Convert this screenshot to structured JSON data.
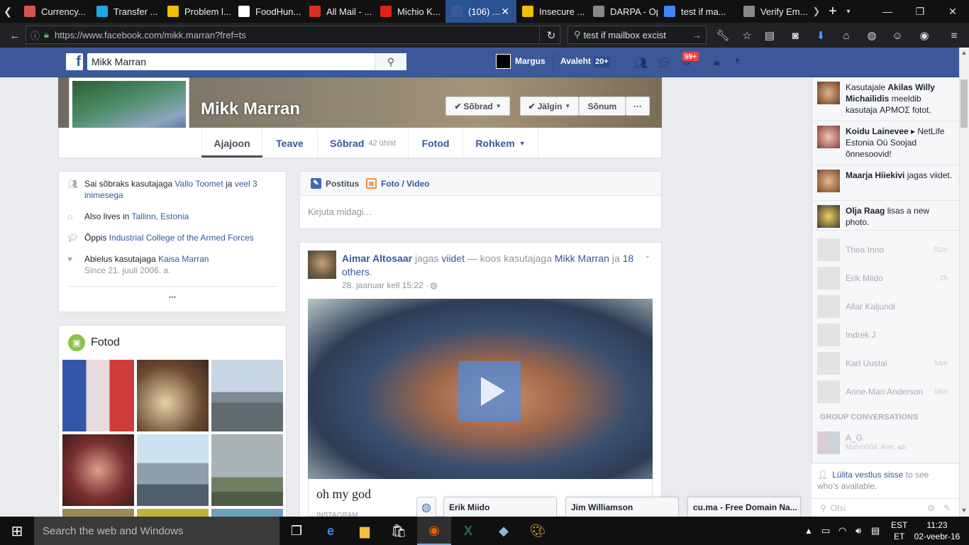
{
  "browser": {
    "tabs": [
      {
        "label": "Currency...",
        "icon": "currency-icon",
        "color": "#d9534f"
      },
      {
        "label": "Transfer ...",
        "icon": "transferwise-icon",
        "color": "#1ea7e1"
      },
      {
        "label": "Problem l...",
        "icon": "warning-icon",
        "color": "#f0c000"
      },
      {
        "label": "FoodHun...",
        "icon": "foodhunter-icon",
        "color": "#ffffff"
      },
      {
        "label": "All Mail - ...",
        "icon": "gmail-icon",
        "color": "#d93025"
      },
      {
        "label": "Michio K...",
        "icon": "youtube-icon",
        "color": "#e62117"
      },
      {
        "label": "(106) ...",
        "icon": "facebook-icon",
        "color": "#3b5998"
      },
      {
        "label": "Insecure ...",
        "icon": "warning-icon",
        "color": "#f0c000"
      },
      {
        "label": "DARPA - Ope...",
        "icon": "blank-icon",
        "color": "#888888"
      },
      {
        "label": "test if ma...",
        "icon": "google-icon",
        "color": "#4285f4"
      },
      {
        "label": "Verify Em...",
        "icon": "blank-icon",
        "color": "#888888"
      }
    ],
    "url": "https://www.facebook.com/mikk.marran?fref=ts",
    "search_query": "test if mailbox excist"
  },
  "fb_header": {
    "search_value": "Mikk Marran",
    "user_name": "Margus",
    "home_label": "Avaleht",
    "home_count": "20+",
    "notif_count": "99+"
  },
  "profile": {
    "name": "Mikk Marran",
    "friends_button": "Sõbrad",
    "follow_button": "Jälgin",
    "message_button": "Sõnum",
    "more_button": "···",
    "tabs": {
      "timeline": "Ajajoon",
      "about": "Teave",
      "friends": "Sõbrad",
      "friends_mutual": "42 ühist",
      "photos": "Fotod",
      "more": "Rohkem"
    }
  },
  "intro": {
    "row1_pre": "Sai sõbraks kasutajaga ",
    "row1_link1": "Vallo Toomet",
    "row1_mid": " ja ",
    "row1_link2": "veel 3 inimesega",
    "row2_pre": "Also lives in ",
    "row2_link": "Tallinn, Estonia",
    "row3_pre": "Õppis ",
    "row3_link": "Industrial College of the Armed Forces",
    "row4_pre": "Abielus kasutajaga ",
    "row4_link": "Kaisa Marran",
    "row4_sub": "Since 21. juuli 2006. a.",
    "more": "•••"
  },
  "photos_card": {
    "title": "Fotod"
  },
  "composer": {
    "tab_post": "Postitus",
    "tab_photo": "Foto / Video",
    "placeholder": "Kirjuta midagi..."
  },
  "post": {
    "author": "Aimar Altosaar",
    "verb": " jagas ",
    "object": "viidet",
    "with": " — koos kasutajaga ",
    "tagged": "Mikk Marran",
    "and": " ja ",
    "others": "18 others",
    "date": "28. jaanuar kell 15:22 · ",
    "caption": "oh my god",
    "source": "INSTAGRAM"
  },
  "ticker": [
    {
      "pre": "Kasutajale ",
      "name": "Akilas Willy Michailidis",
      "rest": " meeldib kasutaja ΑΡΜΟΣ fotot."
    },
    {
      "pre": "",
      "name": "Koidu Lainevee",
      "rest": " ▸ NetLife Estonia Oü Soojad õnnesoovid!"
    },
    {
      "pre": "",
      "name": "Maarja Hiiekivi",
      "rest": " jagas viidet."
    },
    {
      "pre": "",
      "name": "Olja Raag",
      "rest": " lisas a new photo."
    }
  ],
  "contacts": [
    {
      "name": "Thea Inno",
      "time": "51m"
    },
    {
      "name": "Erik Miido",
      "time": "2h"
    },
    {
      "name": "Allar Kaljundi",
      "time": ""
    },
    {
      "name": "Indrek J",
      "time": ""
    },
    {
      "name": "Karl Uustal",
      "time": "54m"
    },
    {
      "name": "Anne-Mari Anderson",
      "time": "16m"
    }
  ],
  "group_header": "GROUP CONVERSATIONS",
  "group": {
    "name": "A_G",
    "members": "Mahmŏŭd, Amr, ﷲ"
  },
  "chat_footer": {
    "link": "Lülita vestlus sisse",
    "rest": " to see who's available.",
    "search_placeholder": "Otsi"
  },
  "chat_tabs": [
    "Erik Miido",
    "Jim Williamson",
    "cu.ma - Free Domain Na..."
  ],
  "taskbar": {
    "search_placeholder": "Search the web and Windows",
    "lang1": "EST",
    "lang2": "ET",
    "time": "11:23",
    "date": "02-veebr-16"
  }
}
